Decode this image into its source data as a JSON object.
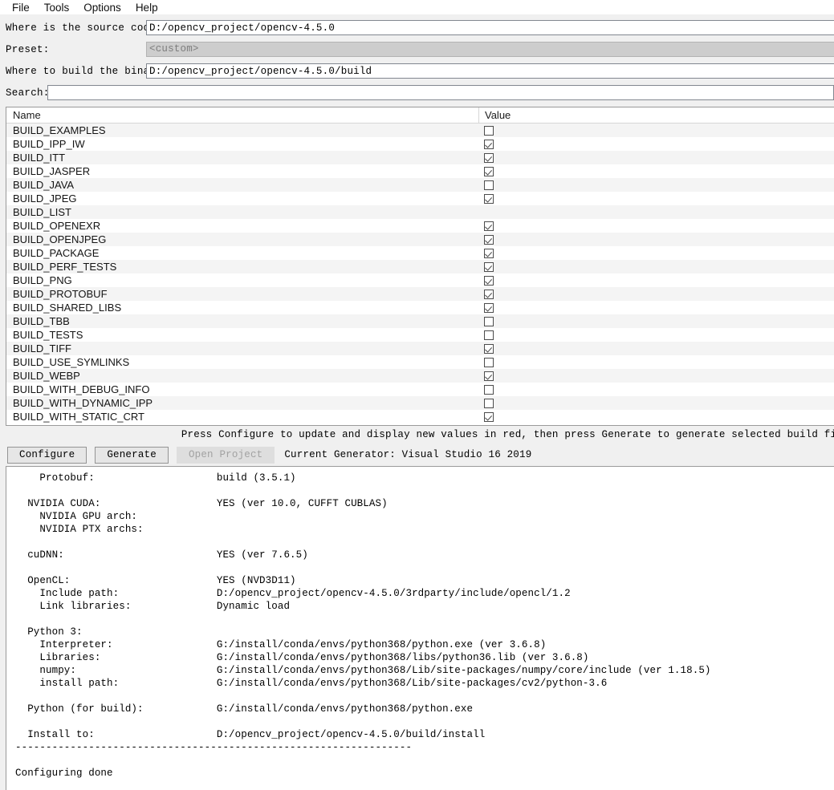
{
  "menubar": {
    "items": [
      {
        "label": "File"
      },
      {
        "label": "Tools"
      },
      {
        "label": "Options"
      },
      {
        "label": "Help"
      }
    ]
  },
  "form": {
    "source_label": "Where is the source code:",
    "source_value": "D:/opencv_project/opencv-4.5.0",
    "preset_label": "Preset:",
    "preset_value": "<custom>",
    "binaries_label": "Where to build the binaries:",
    "binaries_value": "D:/opencv_project/opencv-4.5.0/build",
    "search_label": "Search:",
    "search_value": "",
    "search_placeholder": ""
  },
  "table": {
    "columns": [
      "Name",
      "Value"
    ],
    "rows": [
      {
        "name": "BUILD_EXAMPLES",
        "checked": false
      },
      {
        "name": "BUILD_IPP_IW",
        "checked": true
      },
      {
        "name": "BUILD_ITT",
        "checked": true
      },
      {
        "name": "BUILD_JASPER",
        "checked": true
      },
      {
        "name": "BUILD_JAVA",
        "checked": false
      },
      {
        "name": "BUILD_JPEG",
        "checked": true
      },
      {
        "name": "BUILD_LIST",
        "checked": null
      },
      {
        "name": "BUILD_OPENEXR",
        "checked": true
      },
      {
        "name": "BUILD_OPENJPEG",
        "checked": true
      },
      {
        "name": "BUILD_PACKAGE",
        "checked": true
      },
      {
        "name": "BUILD_PERF_TESTS",
        "checked": true
      },
      {
        "name": "BUILD_PNG",
        "checked": true
      },
      {
        "name": "BUILD_PROTOBUF",
        "checked": true
      },
      {
        "name": "BUILD_SHARED_LIBS",
        "checked": true
      },
      {
        "name": "BUILD_TBB",
        "checked": false
      },
      {
        "name": "BUILD_TESTS",
        "checked": false
      },
      {
        "name": "BUILD_TIFF",
        "checked": true
      },
      {
        "name": "BUILD_USE_SYMLINKS",
        "checked": false
      },
      {
        "name": "BUILD_WEBP",
        "checked": true
      },
      {
        "name": "BUILD_WITH_DEBUG_INFO",
        "checked": false
      },
      {
        "name": "BUILD_WITH_DYNAMIC_IPP",
        "checked": false
      },
      {
        "name": "BUILD_WITH_STATIC_CRT",
        "checked": true
      }
    ]
  },
  "hint": "Press Configure to update and display new values in red, then press Generate to generate selected build files.",
  "buttons": {
    "configure": "Configure",
    "generate": "Generate",
    "open_project": "Open Project",
    "generator_text": "Current Generator: Visual Studio 16 2019"
  },
  "log": {
    "text": "    Protobuf:                    build (3.5.1)\n\n  NVIDIA CUDA:                   YES (ver 10.0, CUFFT CUBLAS)\n    NVIDIA GPU arch:\n    NVIDIA PTX archs:\n\n  cuDNN:                         YES (ver 7.6.5)\n\n  OpenCL:                        YES (NVD3D11)\n    Include path:                D:/opencv_project/opencv-4.5.0/3rdparty/include/opencl/1.2\n    Link libraries:              Dynamic load\n\n  Python 3:\n    Interpreter:                 G:/install/conda/envs/python368/python.exe (ver 3.6.8)\n    Libraries:                   G:/install/conda/envs/python368/libs/python36.lib (ver 3.6.8)\n    numpy:                       G:/install/conda/envs/python368/Lib/site-packages/numpy/core/include (ver 1.18.5)\n    install path:                G:/install/conda/envs/python368/Lib/site-packages/cv2/python-3.6\n\n  Python (for build):            G:/install/conda/envs/python368/python.exe\n\n  Install to:                    D:/opencv_project/opencv-4.5.0/build/install\n-----------------------------------------------------------------\n\nConfiguring done"
  }
}
